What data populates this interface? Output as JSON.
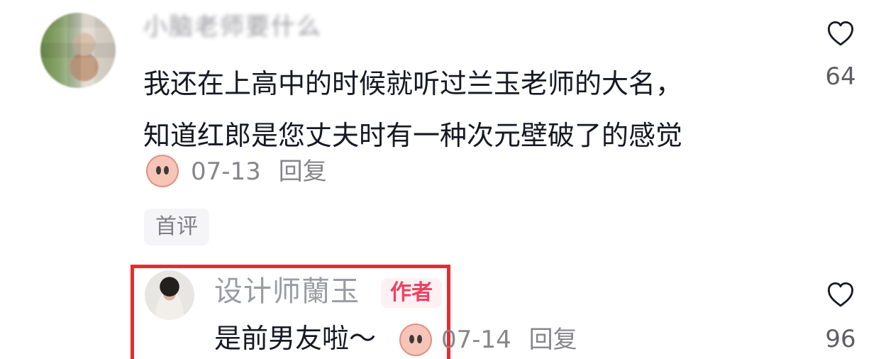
{
  "comments": [
    {
      "username": "小脑老师要什么",
      "text_line1": "我还在上高中的时候就听过兰玉老师的大名，",
      "text_line2": "知道红郎是您丈夫时有一种次元壁破了的感觉",
      "date": "07-13",
      "reply_label": "回复",
      "like_count": "64",
      "badge": "首评",
      "icons": {
        "avatar": "avatar-icon",
        "sticker": "cartoon-face-icon",
        "like": "heart-icon"
      }
    },
    {
      "username": "设计师蘭玉",
      "author_tag": "作者",
      "text": "是前男友啦～",
      "date": "07-14",
      "reply_label": "回复",
      "like_count": "96",
      "icons": {
        "avatar": "avatar-icon",
        "sticker": "cartoon-face-icon",
        "like": "heart-icon"
      }
    }
  ],
  "colors": {
    "text_primary": "#161823",
    "text_secondary": "#86868b",
    "author_tag": "#f0405f",
    "highlight_border": "#e52d2f"
  }
}
